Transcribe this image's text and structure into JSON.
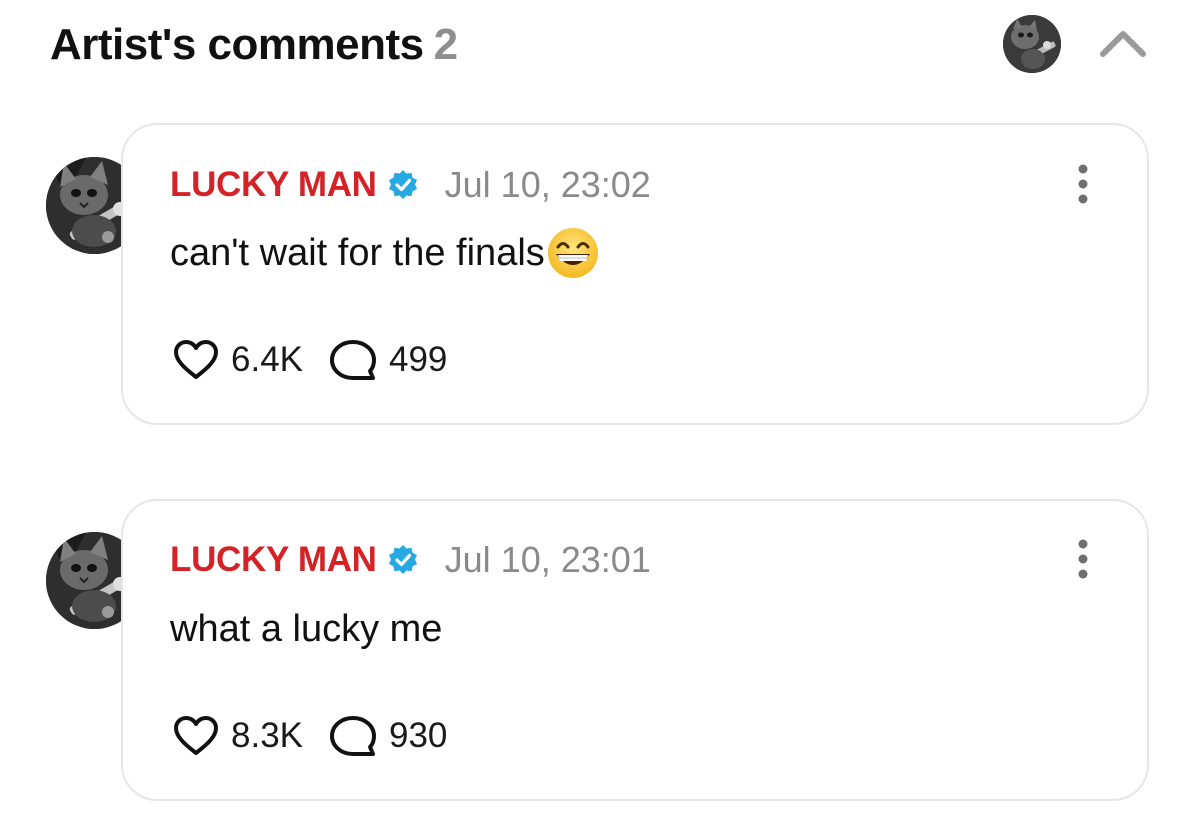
{
  "header": {
    "title": "Artist's comments",
    "count": "2"
  },
  "comments": [
    {
      "author": "LUCKY MAN",
      "timestamp": "Jul 10, 23:02",
      "text": "can't wait for the finals",
      "emoji": "grinning-face-with-smiling-eyes",
      "likes": "6.4K",
      "replies": "499"
    },
    {
      "author": "LUCKY MAN",
      "timestamp": "Jul 10, 23:01",
      "text": "what a lucky me",
      "likes": "8.3K",
      "replies": "930"
    }
  ],
  "colors": {
    "author_name": "#d42226",
    "verified_badge": "#25a9e0",
    "timestamp": "#8a8a8a",
    "count_grey": "#8e8e8e",
    "card_border": "#e6e6e6"
  },
  "icons": {
    "collapse": "chevron-up-icon",
    "more": "vertical-ellipsis-icon",
    "like": "heart-outline-icon",
    "reply": "speech-bubble-icon",
    "verified": "verified-badge-icon"
  }
}
